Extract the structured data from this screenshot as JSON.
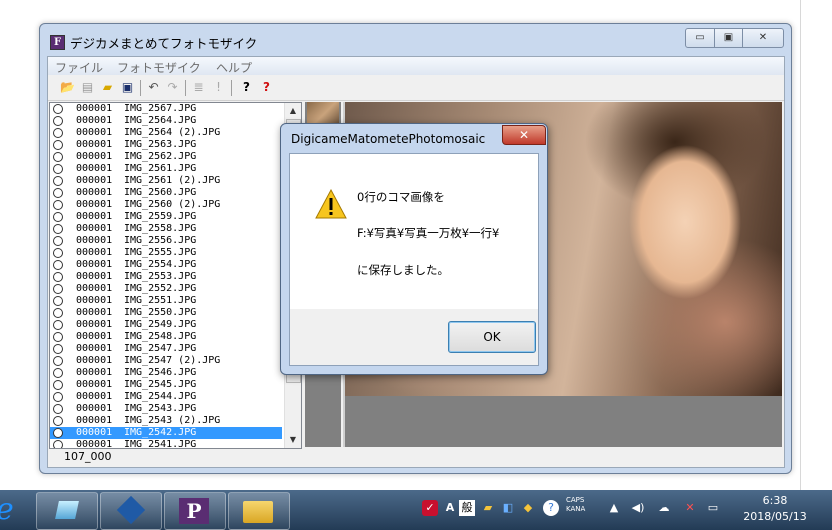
{
  "window": {
    "title": "デジカメまとめてフォトモザイク",
    "icon_letter": "F",
    "caption_min": "▭",
    "caption_max": "▣",
    "caption_close": "✕"
  },
  "menu": [
    "ファイル",
    "フォトモザイク",
    "ヘルプ"
  ],
  "toolbar_icons": [
    "open-folder-icon",
    "document-icon",
    "folder-icon",
    "save-icon",
    "undo-icon",
    "redo-icon",
    "list-icon",
    "exclamation-icon",
    "help-icon",
    "help-red-icon"
  ],
  "list": {
    "rows": [
      {
        "id": "000001",
        "file": "IMG_2567.JPG"
      },
      {
        "id": "000001",
        "file": "IMG_2564.JPG"
      },
      {
        "id": "000001",
        "file": "IMG_2564 (2).JPG"
      },
      {
        "id": "000001",
        "file": "IMG_2563.JPG"
      },
      {
        "id": "000001",
        "file": "IMG_2562.JPG"
      },
      {
        "id": "000001",
        "file": "IMG_2561.JPG"
      },
      {
        "id": "000001",
        "file": "IMG_2561 (2).JPG"
      },
      {
        "id": "000001",
        "file": "IMG_2560.JPG"
      },
      {
        "id": "000001",
        "file": "IMG_2560 (2).JPG"
      },
      {
        "id": "000001",
        "file": "IMG_2559.JPG"
      },
      {
        "id": "000001",
        "file": "IMG_2558.JPG"
      },
      {
        "id": "000001",
        "file": "IMG_2556.JPG"
      },
      {
        "id": "000001",
        "file": "IMG_2555.JPG"
      },
      {
        "id": "000001",
        "file": "IMG_2554.JPG"
      },
      {
        "id": "000001",
        "file": "IMG_2553.JPG"
      },
      {
        "id": "000001",
        "file": "IMG_2552.JPG"
      },
      {
        "id": "000001",
        "file": "IMG_2551.JPG"
      },
      {
        "id": "000001",
        "file": "IMG_2550.JPG"
      },
      {
        "id": "000001",
        "file": "IMG_2549.JPG"
      },
      {
        "id": "000001",
        "file": "IMG_2548.JPG"
      },
      {
        "id": "000001",
        "file": "IMG_2547.JPG"
      },
      {
        "id": "000001",
        "file": "IMG_2547 (2).JPG"
      },
      {
        "id": "000001",
        "file": "IMG_2546.JPG"
      },
      {
        "id": "000001",
        "file": "IMG_2545.JPG"
      },
      {
        "id": "000001",
        "file": "IMG_2544.JPG"
      },
      {
        "id": "000001",
        "file": "IMG_2543.JPG"
      },
      {
        "id": "000001",
        "file": "IMG_2543 (2).JPG"
      },
      {
        "id": "000001",
        "file": "IMG_2542.JPG",
        "selected": true
      },
      {
        "id": "000001",
        "file": "IMG_2541.JPG"
      }
    ]
  },
  "status": {
    "count": "107_000"
  },
  "dialog": {
    "title": "DigicameMatometePhotomosaic",
    "line1": "0行のコマ画像を",
    "line2": "F:¥写真¥写真一万枚¥一行¥",
    "line3": "に保存しました。",
    "ok": "OK"
  },
  "tray": {
    "ime_a": "A",
    "ime_mode": "般",
    "caps": "CAPS",
    "kana": "KANA",
    "time": "6:38",
    "date": "2018/05/13"
  },
  "colors": {
    "selection": "#3399ff",
    "taskbar": "#2d4763",
    "dialog_close": "#c0392b"
  }
}
